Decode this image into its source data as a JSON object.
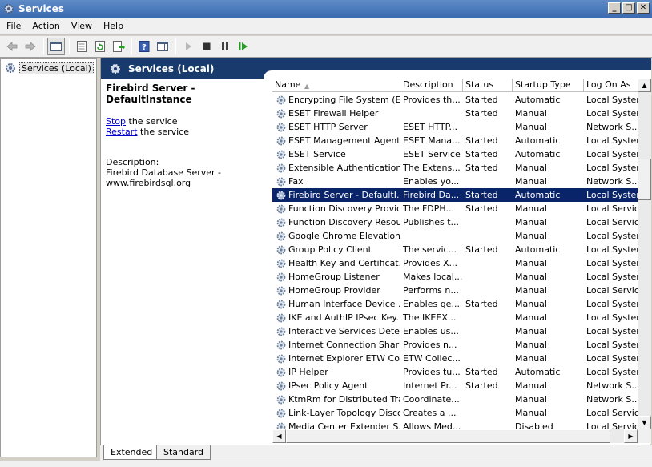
{
  "window": {
    "title": "Services"
  },
  "menu": [
    "File",
    "Action",
    "View",
    "Help"
  ],
  "toolbar": {
    "buttons": [
      "back-icon",
      "forward-icon",
      "show-hide-console-tree-icon",
      "properties-icon",
      "refresh-icon",
      "export-list-icon",
      "help-icon",
      "show-hide-action-pane-icon",
      "start-service-icon",
      "stop-service-icon",
      "pause-service-icon",
      "restart-service-icon"
    ]
  },
  "tree": {
    "root_label": "Services (Local)"
  },
  "header": {
    "title": "Services (Local)"
  },
  "detail": {
    "service_name": "Firebird Server - DefaultInstance",
    "stop_link": "Stop",
    "stop_suffix": " the service",
    "restart_link": "Restart",
    "restart_suffix": " the service",
    "description_label": "Description:",
    "description_line1": "Firebird Database Server -",
    "description_line2": "www.firebirdsql.org"
  },
  "columns": [
    "Name",
    "Description",
    "Status",
    "Startup Type",
    "Log On As"
  ],
  "rows": [
    {
      "name": "Encrypting File System (E...",
      "desc": "Provides th...",
      "status": "Started",
      "startup": "Automatic",
      "logon": "Local System"
    },
    {
      "name": "ESET Firewall Helper",
      "desc": "",
      "status": "Started",
      "startup": "Manual",
      "logon": "Local System"
    },
    {
      "name": "ESET HTTP Server",
      "desc": "ESET HTTP...",
      "status": "",
      "startup": "Manual",
      "logon": "Network S..."
    },
    {
      "name": "ESET Management Agent",
      "desc": "ESET Mana...",
      "status": "Started",
      "startup": "Automatic",
      "logon": "Local System"
    },
    {
      "name": "ESET Service",
      "desc": "ESET Service",
      "status": "Started",
      "startup": "Automatic",
      "logon": "Local System"
    },
    {
      "name": "Extensible Authentication...",
      "desc": "The Extens...",
      "status": "Started",
      "startup": "Manual",
      "logon": "Local System"
    },
    {
      "name": "Fax",
      "desc": "Enables yo...",
      "status": "",
      "startup": "Manual",
      "logon": "Network S..."
    },
    {
      "name": "Firebird Server - DefaultI...",
      "desc": "Firebird Da...",
      "status": "Started",
      "startup": "Automatic",
      "logon": "Local System",
      "selected": true
    },
    {
      "name": "Function Discovery Provid...",
      "desc": "The FDPH...",
      "status": "Started",
      "startup": "Manual",
      "logon": "Local Service"
    },
    {
      "name": "Function Discovery Resou...",
      "desc": "Publishes t...",
      "status": "",
      "startup": "Manual",
      "logon": "Local Service"
    },
    {
      "name": "Google Chrome Elevation ...",
      "desc": "",
      "status": "",
      "startup": "Manual",
      "logon": "Local System"
    },
    {
      "name": "Group Policy Client",
      "desc": "The servic...",
      "status": "Started",
      "startup": "Automatic",
      "logon": "Local System"
    },
    {
      "name": "Health Key and Certificat...",
      "desc": "Provides X...",
      "status": "",
      "startup": "Manual",
      "logon": "Local System"
    },
    {
      "name": "HomeGroup Listener",
      "desc": "Makes local...",
      "status": "",
      "startup": "Manual",
      "logon": "Local System"
    },
    {
      "name": "HomeGroup Provider",
      "desc": "Performs n...",
      "status": "",
      "startup": "Manual",
      "logon": "Local Service"
    },
    {
      "name": "Human Interface Device ...",
      "desc": "Enables ge...",
      "status": "Started",
      "startup": "Manual",
      "logon": "Local System"
    },
    {
      "name": "IKE and AuthIP IPsec Key...",
      "desc": "The IKEEX...",
      "status": "",
      "startup": "Manual",
      "logon": "Local System"
    },
    {
      "name": "Interactive Services Dete...",
      "desc": "Enables us...",
      "status": "",
      "startup": "Manual",
      "logon": "Local System"
    },
    {
      "name": "Internet Connection Shari...",
      "desc": "Provides n...",
      "status": "",
      "startup": "Manual",
      "logon": "Local System"
    },
    {
      "name": "Internet Explorer ETW Co...",
      "desc": "ETW Collec...",
      "status": "",
      "startup": "Manual",
      "logon": "Local System"
    },
    {
      "name": "IP Helper",
      "desc": "Provides tu...",
      "status": "Started",
      "startup": "Automatic",
      "logon": "Local System"
    },
    {
      "name": "IPsec Policy Agent",
      "desc": "Internet Pr...",
      "status": "Started",
      "startup": "Manual",
      "logon": "Network S..."
    },
    {
      "name": "KtmRm for Distributed Tra...",
      "desc": "Coordinate...",
      "status": "",
      "startup": "Manual",
      "logon": "Network S..."
    },
    {
      "name": "Link-Layer Topology Disco...",
      "desc": "Creates a ...",
      "status": "",
      "startup": "Manual",
      "logon": "Local Service"
    },
    {
      "name": "Media Center Extender S...",
      "desc": "Allows Med...",
      "status": "",
      "startup": "Disabled",
      "logon": "Local Service"
    }
  ],
  "tabs": [
    "Extended",
    "Standard"
  ],
  "colors": {
    "selection": "#0a246a",
    "header_band": "#183a6d",
    "link": "#0000cc"
  }
}
